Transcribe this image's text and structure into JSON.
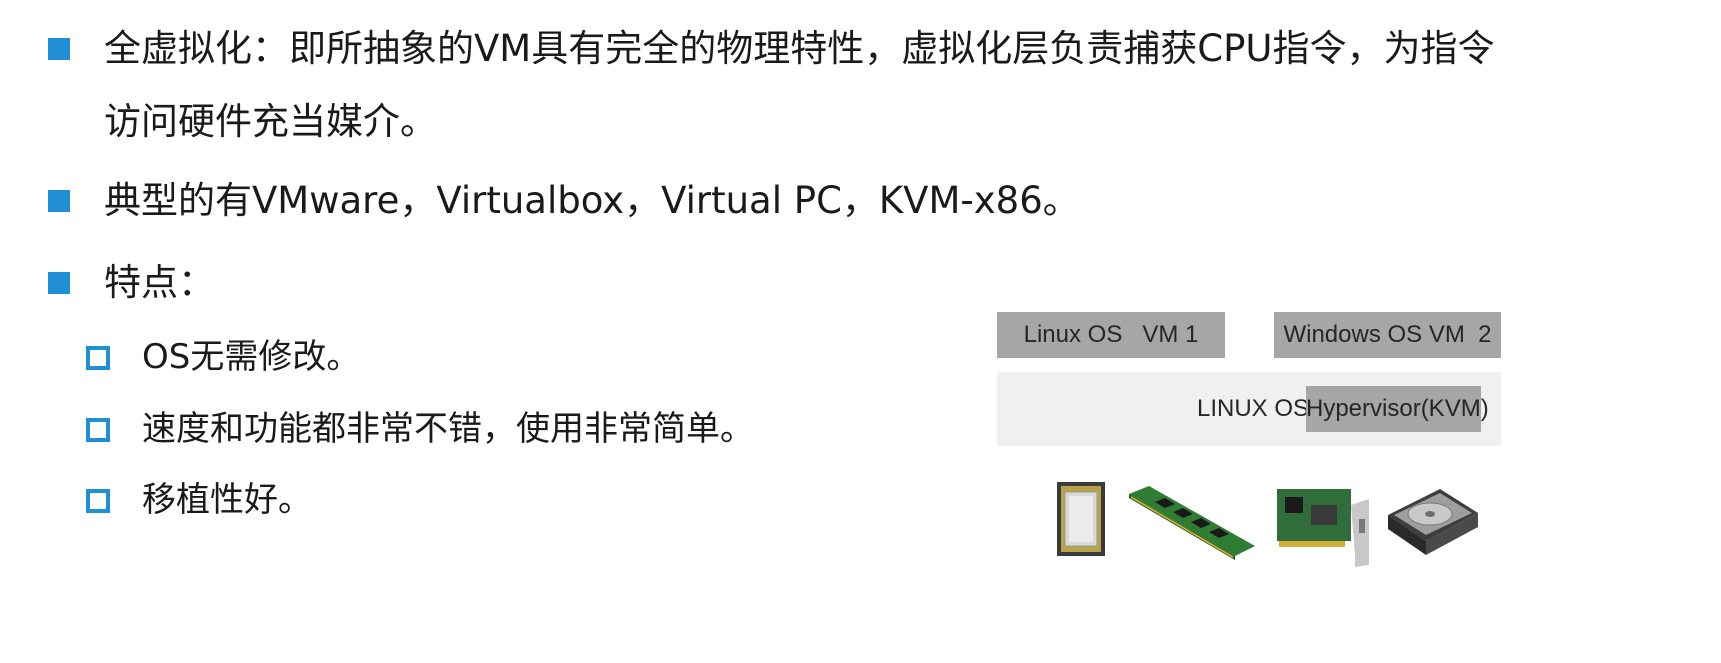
{
  "bullets": [
    {
      "line1": "全虚拟化：即所抽象的VM具有完全的物理特性，虚拟化层负责捕获CPU指令，为指令",
      "line2": "访问硬件充当媒介。"
    },
    {
      "line1": "典型的有VMware，Virtualbox，Virtual PC，KVM-x86。"
    },
    {
      "line1": "特点："
    }
  ],
  "sub_bullets": [
    " OS无需修改。",
    "速度和功能都非常不错，使用非常简单。",
    "移植性好。"
  ],
  "diagram": {
    "vm1_label": "Linux OS   VM 1",
    "vm2_label": "Windows OS VM  2",
    "host_label": "LINUX OS ",
    "hypervisor_label": "Hypervisor(KVM)",
    "hardware_icons": [
      "cpu-icon",
      "ram-module-icon",
      "network-card-icon",
      "hard-disk-icon"
    ]
  },
  "colors": {
    "bullet": "#1f8fd6",
    "vm_box": "#a6a6a6",
    "host_box": "#f0f0f0"
  }
}
